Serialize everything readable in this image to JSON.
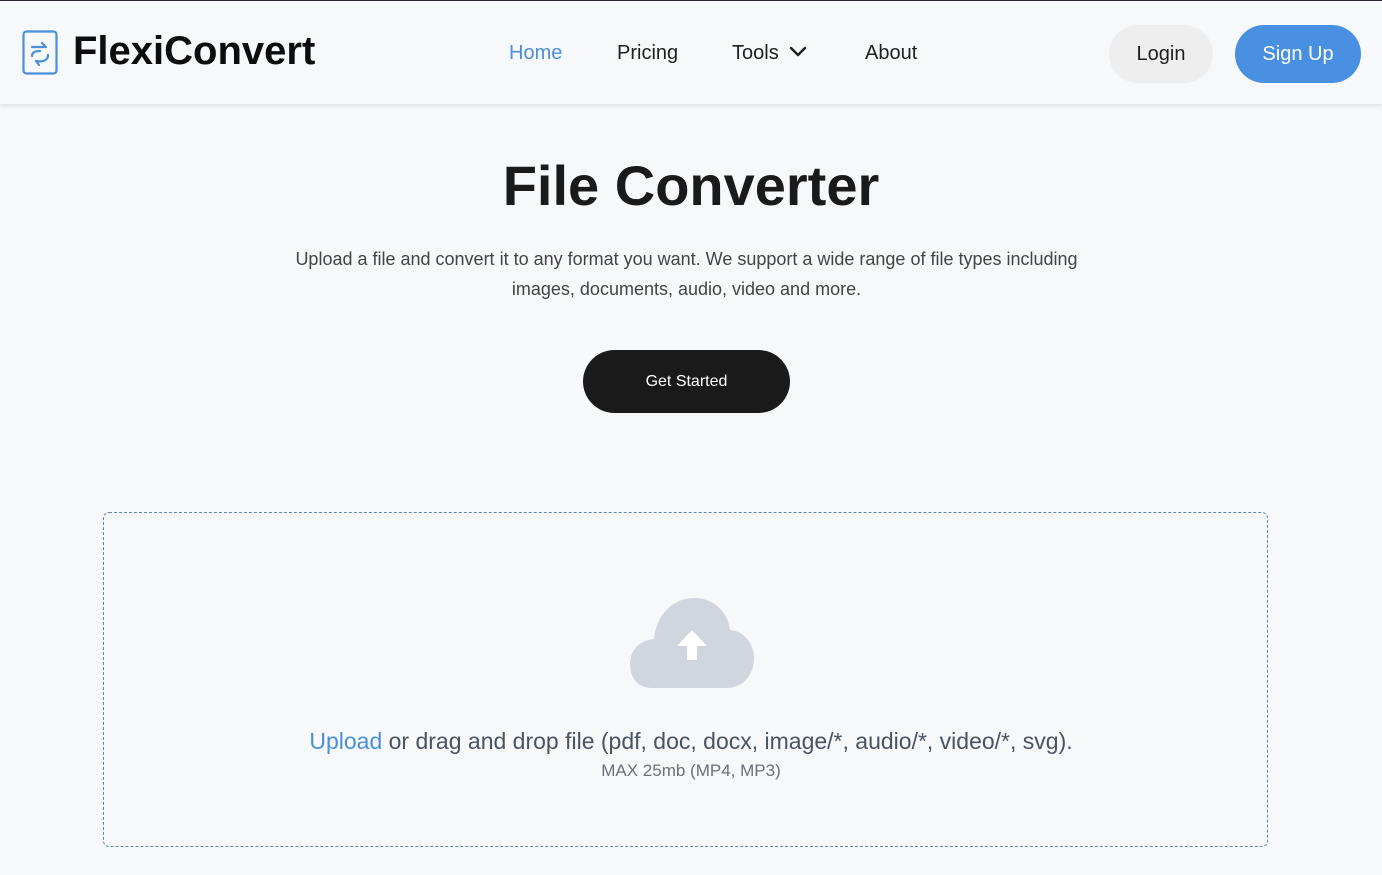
{
  "header": {
    "brand": "FlexiConvert",
    "nav": {
      "home": "Home",
      "pricing": "Pricing",
      "tools": "Tools",
      "about": "About"
    },
    "login_label": "Login",
    "signup_label": "Sign Up"
  },
  "hero": {
    "title": "File Converter",
    "description": "Upload a file and convert it to any format you want. We support a wide range of file types including images, documents, audio, video and more.",
    "cta_label": "Get Started"
  },
  "dropzone": {
    "upload_link": "Upload",
    "instruction": " or drag and drop file (pdf, doc, docx, image/*, audio/*, video/*, svg).",
    "limit": "MAX 25mb (MP4, MP3)"
  },
  "colors": {
    "accent": "#4a90e2",
    "dark_button": "#1a1a1a",
    "background": "#f7f8fa",
    "cloud_icon": "#d1d5de"
  },
  "icons": {
    "logo": "file-convert-icon",
    "tools_dropdown": "chevron-down-icon",
    "upload": "cloud-upload-icon"
  }
}
